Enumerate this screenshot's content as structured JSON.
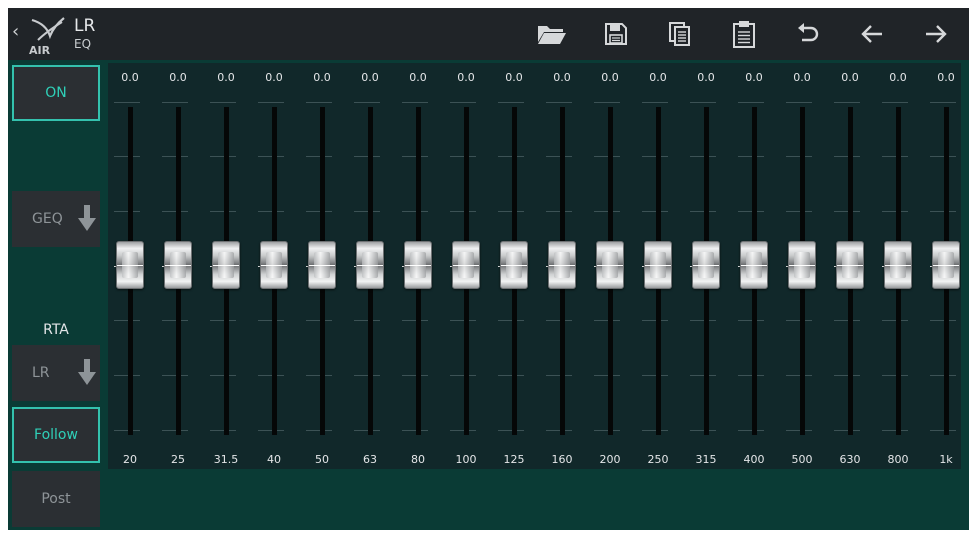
{
  "header": {
    "back_symbol": "‹",
    "title": "LR",
    "subtitle": "EQ",
    "logo_text": "AIR",
    "tools": [
      {
        "name": "open-folder-icon"
      },
      {
        "name": "save-icon"
      },
      {
        "name": "copy-icon"
      },
      {
        "name": "paste-icon"
      },
      {
        "name": "undo-icon"
      },
      {
        "name": "arrow-left-icon"
      },
      {
        "name": "arrow-right-icon"
      }
    ]
  },
  "sidebar": {
    "on_label": "ON",
    "eq_type_label": "GEQ",
    "rta_label": "RTA",
    "rta_source_label": "LR",
    "follow_label": "Follow",
    "post_label": "Post"
  },
  "geq": {
    "bands": [
      {
        "freq": "20",
        "gain": "0.0"
      },
      {
        "freq": "25",
        "gain": "0.0"
      },
      {
        "freq": "31.5",
        "gain": "0.0"
      },
      {
        "freq": "40",
        "gain": "0.0"
      },
      {
        "freq": "50",
        "gain": "0.0"
      },
      {
        "freq": "63",
        "gain": "0.0"
      },
      {
        "freq": "80",
        "gain": "0.0"
      },
      {
        "freq": "100",
        "gain": "0.0"
      },
      {
        "freq": "125",
        "gain": "0.0"
      },
      {
        "freq": "160",
        "gain": "0.0"
      },
      {
        "freq": "200",
        "gain": "0.0"
      },
      {
        "freq": "250",
        "gain": "0.0"
      },
      {
        "freq": "315",
        "gain": "0.0"
      },
      {
        "freq": "400",
        "gain": "0.0"
      },
      {
        "freq": "500",
        "gain": "0.0"
      },
      {
        "freq": "630",
        "gain": "0.0"
      },
      {
        "freq": "800",
        "gain": "0.0"
      },
      {
        "freq": "1k",
        "gain": "0.0"
      }
    ]
  },
  "colors": {
    "accent": "#34c2ae",
    "panel_bg": "#0a3b35",
    "header_bg": "#202428",
    "geq_bg": "#11282a"
  }
}
